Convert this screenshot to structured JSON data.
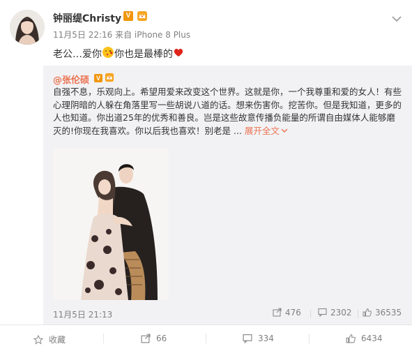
{
  "post": {
    "author": "钟丽缇Christy",
    "verified_badge": "V",
    "meta": "11月5日 22:16 来自 iPhone 8 Plus",
    "text_before": "老公…爱你",
    "text_after": "你也是最棒的"
  },
  "repost": {
    "author": "@张伦硕",
    "verified_badge": "V",
    "text": "自强不息，乐观向上。希望用爱来改变这个世界。这就是你，一个我尊重和爱的女人！有些心理阴暗的人躲在角落里写一些胡说八道的话。想来伤害你。挖苦你。但是我知道，更多的人也知道。你出道25年的优秀和善良。岂是这些故意传播负能量的所谓自由媒体人能够磨灭的!你现在我喜欢。你以后我也喜欢！别老是 ...",
    "expand_label": "展开全文",
    "time": "11月5日 21:13",
    "shares": "476",
    "comments": "2302",
    "likes": "36535"
  },
  "actions": {
    "favorite": "收藏",
    "share": "66",
    "comment": "334",
    "like": "6434"
  },
  "colors": {
    "accent": "#eb7350",
    "badge": "#f2950b",
    "repost_bg": "#f2f2f5",
    "muted": "#808080"
  },
  "icons": [
    "chevron-down-icon",
    "member-crown-icon",
    "kiss-emoji-icon",
    "heart-emoji-icon",
    "share-icon",
    "comment-icon",
    "like-icon",
    "star-icon"
  ]
}
